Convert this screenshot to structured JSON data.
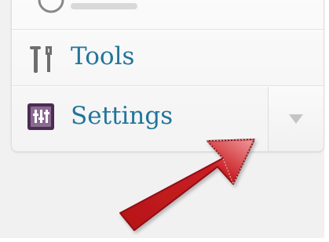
{
  "menu": {
    "tools_label": "Tools",
    "settings_label": "Settings",
    "partial_item_icon": "partial-circle-icon",
    "tools_icon": "tools-icon",
    "settings_icon": "settings-icon",
    "dropdown_icon": "chevron-down-icon"
  },
  "annotation": {
    "arrow_color": "#c4171a",
    "arrow_icon": "red-arrow-icon"
  },
  "colors": {
    "label_text": "#21759b",
    "menu_background": "#f5f5f5",
    "border": "#dfdfdf"
  }
}
